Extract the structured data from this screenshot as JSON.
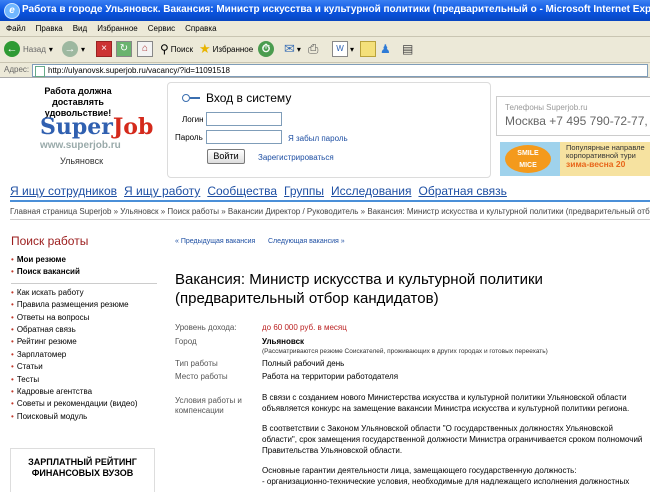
{
  "window": {
    "title": "Работа в городе Ульяновск. Вакансия: Министр искусства и культурной политики (предварительный о - Microsoft Internet Explorer"
  },
  "menu": [
    "Файл",
    "Правка",
    "Вид",
    "Избранное",
    "Сервис",
    "Справка"
  ],
  "toolbar": {
    "back": "Назад",
    "search": "Поиск",
    "favorites": "Избранное"
  },
  "address": {
    "label": "Адрес:",
    "url": "http://ulyanovsk.superjob.ru/vacancy/?id=11091518"
  },
  "header": {
    "tagline": "Работа должна доставлять удовольствие!",
    "logo_super": "Super",
    "logo_job": "Job",
    "logo_url": "www.superjob.ru",
    "city": "Ульяновск"
  },
  "login": {
    "title": "Вход в систему",
    "login_label": "Логин",
    "password_label": "Пароль",
    "forgot": "Я забыл пароль",
    "submit": "Войти",
    "register": "Зарегистрироваться"
  },
  "contacts": {
    "label": "Телефоны Superjob.ru",
    "phone": "Москва +7 495 790-72-77, Н"
  },
  "promo": {
    "badge_line1": "SMILE",
    "badge_line2": "MICE",
    "text1": "Популярные направле",
    "text2": "корпоративной тури",
    "text3": "зима-весна 20"
  },
  "nav": [
    "Я ищу сотрудников",
    "Я ищу работу",
    "Сообщества",
    "Группы",
    "Исследования",
    "Обратная связь"
  ],
  "breadcrumb": "Главная страница Superjob » Ульяновск » Поиск работы » Вакансии Директор / Руководитель » Вакансия: Министр искусства и культурной политики (предварительный отб",
  "sidebar": {
    "title": "Поиск работы",
    "top": [
      {
        "label": "Мои резюме",
        "bold": true
      },
      {
        "label": "Поиск вакансий",
        "bold": true
      }
    ],
    "items": [
      "Как искать работу",
      "Правила размещения резюме",
      "Ответы на вопросы",
      "Обратная связь",
      "Рейтинг резюме",
      "Зарплатомер",
      "Статьи",
      "Тесты",
      "Кадровые агентства",
      "Советы и рекомендации (видео)",
      "Поисковый модуль"
    ],
    "rating": "ЗАРПЛАТНЫЙ РЕЙТИНГ ФИНАНСОВЫХ ВУЗОВ"
  },
  "pager": {
    "prev": "« Предыдущая вакансия",
    "next": "Следующая вакансия »"
  },
  "vacancy": {
    "title": "Вакансия: Министр искусства и культурной политики (предварительный отбор кандидатов)",
    "income_label": "Уровень дохода:",
    "income": "до 60 000 руб. в месяц",
    "city_label": "Город",
    "city": "Ульяновск",
    "city_note": "(Рассматриваются резюме Соискателей, проживающих в других городах и готовых переехать)",
    "worktype_label": "Тип работы",
    "worktype": "Полный рабочий день",
    "place_label": "Место работы",
    "place": "Работа на территории работодателя",
    "conditions_label": "Условия работы и компенсации",
    "paragraphs": [
      "В связи с созданием нового Министерства искусства и культурной политики Ульяновской области объявляется конкурс на замещение вакансии Министра искусства и культурной политики региона.",
      "В соответствии с Законом Ульяновской области \"О государственных должностях Ульяновской области\", срок замещения государственной должности Министра ограничивается сроком полномочий Правительства Ульяновской области.",
      "Основные гарантии деятельности лица, замещающего государственную должность:\n- организационно-технические условия, необходимые для надлежащего исполнения должностных"
    ]
  }
}
